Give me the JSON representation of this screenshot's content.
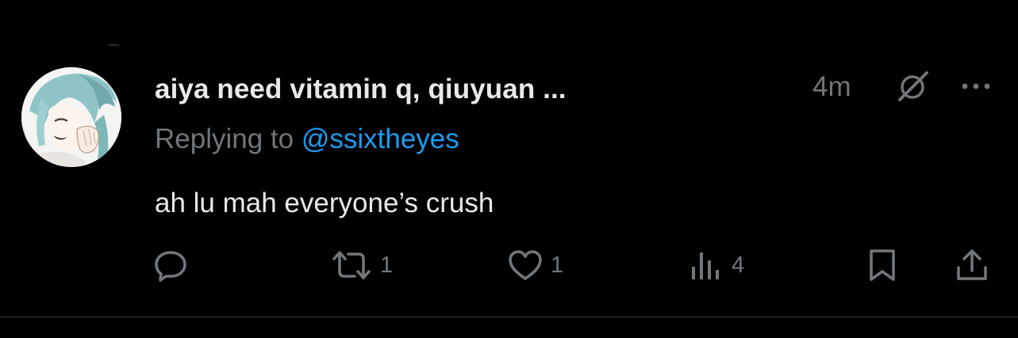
{
  "tweet": {
    "display_name": "aiya need vitamin q, qiuyuan ...",
    "timestamp": "4m",
    "reply_prefix": "Replying to ",
    "reply_handle": "@ssixtheyes",
    "text": "ah lu mah everyone’s crush",
    "avatar_icon": "avatar-anime-character",
    "more_icon": "more-dots-icon",
    "grok_icon": "grok-icon"
  },
  "actions": {
    "reply": {
      "icon": "reply-icon",
      "count": ""
    },
    "retweet": {
      "icon": "retweet-icon",
      "count": "1"
    },
    "like": {
      "icon": "heart-icon",
      "count": "1"
    },
    "views": {
      "icon": "views-icon",
      "count": "4"
    },
    "bookmark": {
      "icon": "bookmark-icon",
      "count": ""
    },
    "share": {
      "icon": "share-icon",
      "count": ""
    }
  },
  "colors": {
    "background": "#000000",
    "primary_text": "#e7e9ea",
    "secondary_text": "#71767b",
    "link": "#1d9bf0",
    "divider": "#2f3336"
  }
}
